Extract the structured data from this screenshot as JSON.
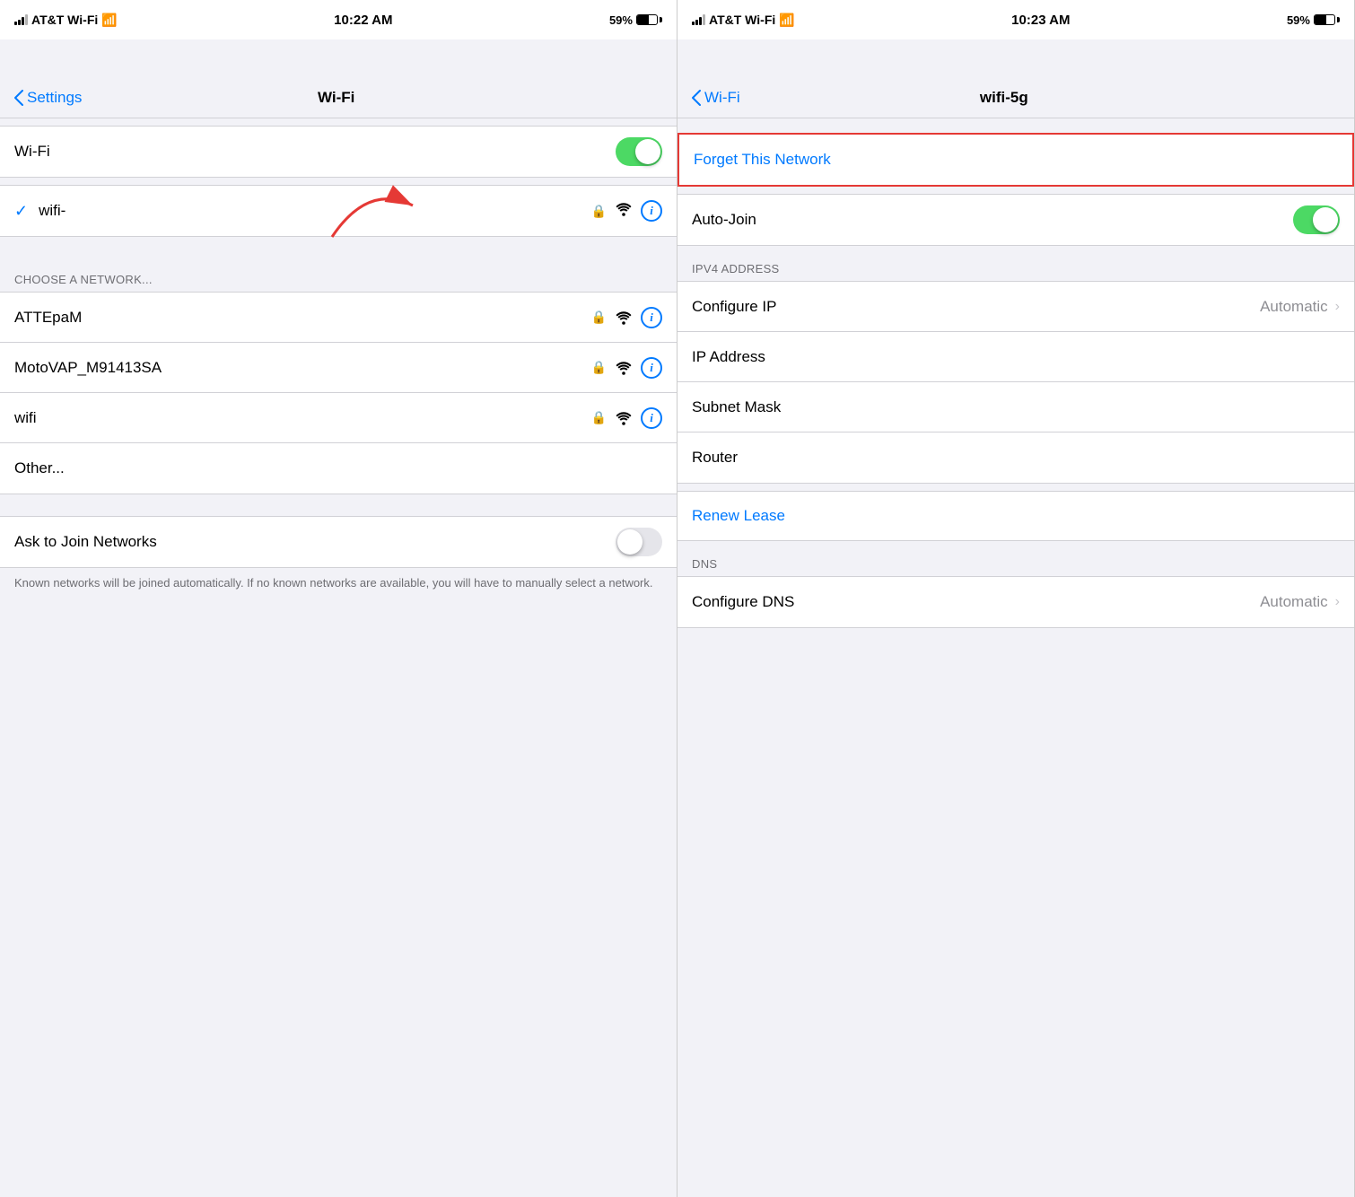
{
  "left_panel": {
    "status_bar": {
      "carrier": "AT&T Wi-Fi",
      "time": "10:22 AM",
      "battery": "59%"
    },
    "nav": {
      "back_label": "Settings",
      "title": "Wi-Fi"
    },
    "wifi_toggle": {
      "label": "Wi-Fi",
      "state": "on"
    },
    "connected_network": {
      "name": "wifi-",
      "connected": true
    },
    "section_header": "CHOOSE A NETWORK...",
    "networks": [
      {
        "name": "ATTEpaM",
        "locked": true
      },
      {
        "name": "MotoVAP_M91413SA",
        "locked": true
      },
      {
        "name": "wifi",
        "locked": true
      }
    ],
    "other_label": "Other...",
    "ask_to_join": {
      "label": "Ask to Join Networks",
      "state": "off"
    },
    "footer_text": "Known networks will be joined automatically. If no known networks are available, you will have to manually select a network."
  },
  "right_panel": {
    "status_bar": {
      "carrier": "AT&T Wi-Fi",
      "time": "10:23 AM",
      "battery": "59%"
    },
    "nav": {
      "back_label": "Wi-Fi",
      "title": "wifi-5g"
    },
    "forget_network_label": "Forget This Network",
    "auto_join": {
      "label": "Auto-Join",
      "state": "on"
    },
    "ipv4_section_header": "IPV4 ADDRESS",
    "configure_ip": {
      "label": "Configure IP",
      "value": "Automatic"
    },
    "ip_address_label": "IP Address",
    "subnet_mask_label": "Subnet Mask",
    "router_label": "Router",
    "renew_lease_label": "Renew Lease",
    "dns_section_header": "DNS",
    "configure_dns": {
      "label": "Configure DNS",
      "value": "Automatic"
    }
  },
  "icons": {
    "lock": "🔒",
    "wifi": "📶",
    "info": "i",
    "check": "✓",
    "chevron": "›"
  }
}
